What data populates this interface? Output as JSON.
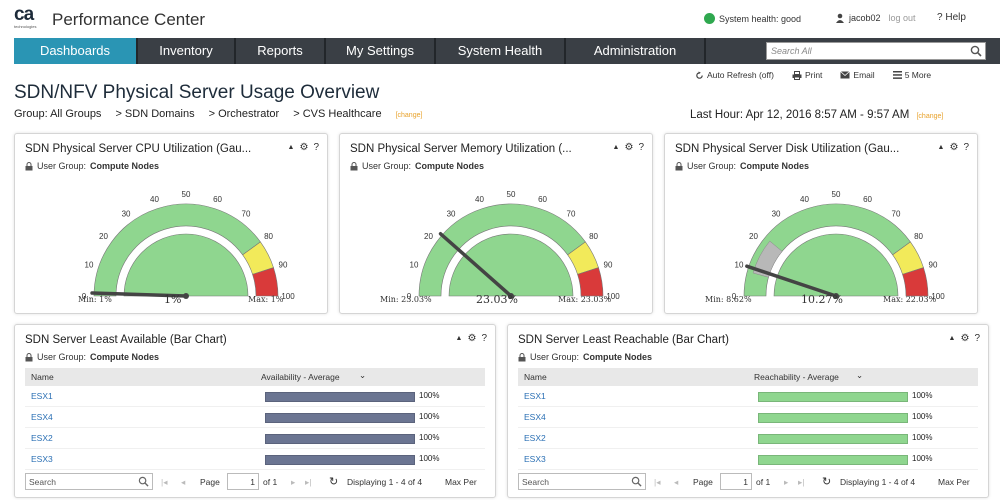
{
  "header": {
    "logo_text": "ca",
    "logo_sub": "technologies",
    "app_title": "Performance Center",
    "system_health": "System health: good",
    "user": "jacob02",
    "logout": "log out",
    "help": "Help"
  },
  "nav": {
    "tabs": [
      "Dashboards",
      "Inventory",
      "Reports",
      "My Settings",
      "System Health",
      "Administration"
    ],
    "search_placeholder": "Search All"
  },
  "page": {
    "actions": [
      "Auto Refresh (off)",
      "Print",
      "Email",
      "5 More"
    ],
    "title": "SDN/NFV Physical Server Usage Overview",
    "breadcrumbs": [
      "Group: All Groups",
      "> SDN Domains",
      "> Orchestrator",
      "> CVS Healthcare"
    ],
    "change_label": "[change]",
    "time_range": "Last Hour: Apr 12, 2016 8:57 AM - 9:57 AM"
  },
  "gauges": [
    {
      "title": "SDN Physical Server CPU Utilization (Gau...",
      "user_group_label": "User Group:",
      "user_group": "Compute Nodes",
      "value": 1,
      "min_label": "Min: 1%",
      "value_label": "1%",
      "max_label": "Max: 1%",
      "min_band": null
    },
    {
      "title": "SDN Physical Server Memory Utilization (...",
      "user_group_label": "User Group:",
      "user_group": "Compute Nodes",
      "value": 23.03,
      "min_label": "Min: 23.03%",
      "value_label": "23.03%",
      "max_label": "Max: 23.03%",
      "min_band": null
    },
    {
      "title": "SDN Physical Server Disk Utilization (Gau...",
      "user_group_label": "User Group:",
      "user_group": "Compute Nodes",
      "value": 10.27,
      "min_label": "Min: 8.62%",
      "value_label": "10.27%",
      "max_label": "Max: 22.03%",
      "min_band": [
        8.62,
        22.03
      ]
    }
  ],
  "gauge_ticks": [
    "0",
    "10",
    "20",
    "30",
    "40",
    "50",
    "60",
    "70",
    "80",
    "90",
    "100"
  ],
  "bar_panels": [
    {
      "title": "SDN Server Least Available (Bar Chart)",
      "user_group_label": "User Group:",
      "user_group": "Compute Nodes",
      "col_name": "Name",
      "col_metric": "Availability - Average",
      "sort_indicator": "⌄",
      "bar_color": "#6b7592",
      "rows": [
        {
          "name": "ESX1",
          "value": 100,
          "label": "100%"
        },
        {
          "name": "ESX4",
          "value": 100,
          "label": "100%"
        },
        {
          "name": "ESX2",
          "value": 100,
          "label": "100%"
        },
        {
          "name": "ESX3",
          "value": 100,
          "label": "100%"
        }
      ],
      "pager": {
        "search": "Search",
        "page": "Page",
        "page_num": "1",
        "of": "of 1",
        "displaying": "Displaying 1 - 4 of 4",
        "max_per": "Max Per"
      }
    },
    {
      "title": "SDN Server Least Reachable (Bar Chart)",
      "user_group_label": "User Group:",
      "user_group": "Compute Nodes",
      "col_name": "Name",
      "col_metric": "Reachability - Average",
      "sort_indicator": "⌄",
      "bar_color": "#8fd68f",
      "rows": [
        {
          "name": "ESX1",
          "value": 100,
          "label": "100%"
        },
        {
          "name": "ESX4",
          "value": 100,
          "label": "100%"
        },
        {
          "name": "ESX2",
          "value": 100,
          "label": "100%"
        },
        {
          "name": "ESX3",
          "value": 100,
          "label": "100%"
        }
      ],
      "pager": {
        "search": "Search",
        "page": "Page",
        "page_num": "1",
        "of": "of 1",
        "displaying": "Displaying 1 - 4 of 4",
        "max_per": "Max Per"
      }
    }
  ],
  "colors": {
    "nav_bg": "#3a3f45",
    "nav_active": "#2a95b4",
    "gauge_green": "#8fd68f",
    "gauge_yellow": "#f2ea5a",
    "gauge_red": "#d93a3a",
    "gauge_band": "#b8b8b8",
    "change_orange": "#e8a22b"
  }
}
